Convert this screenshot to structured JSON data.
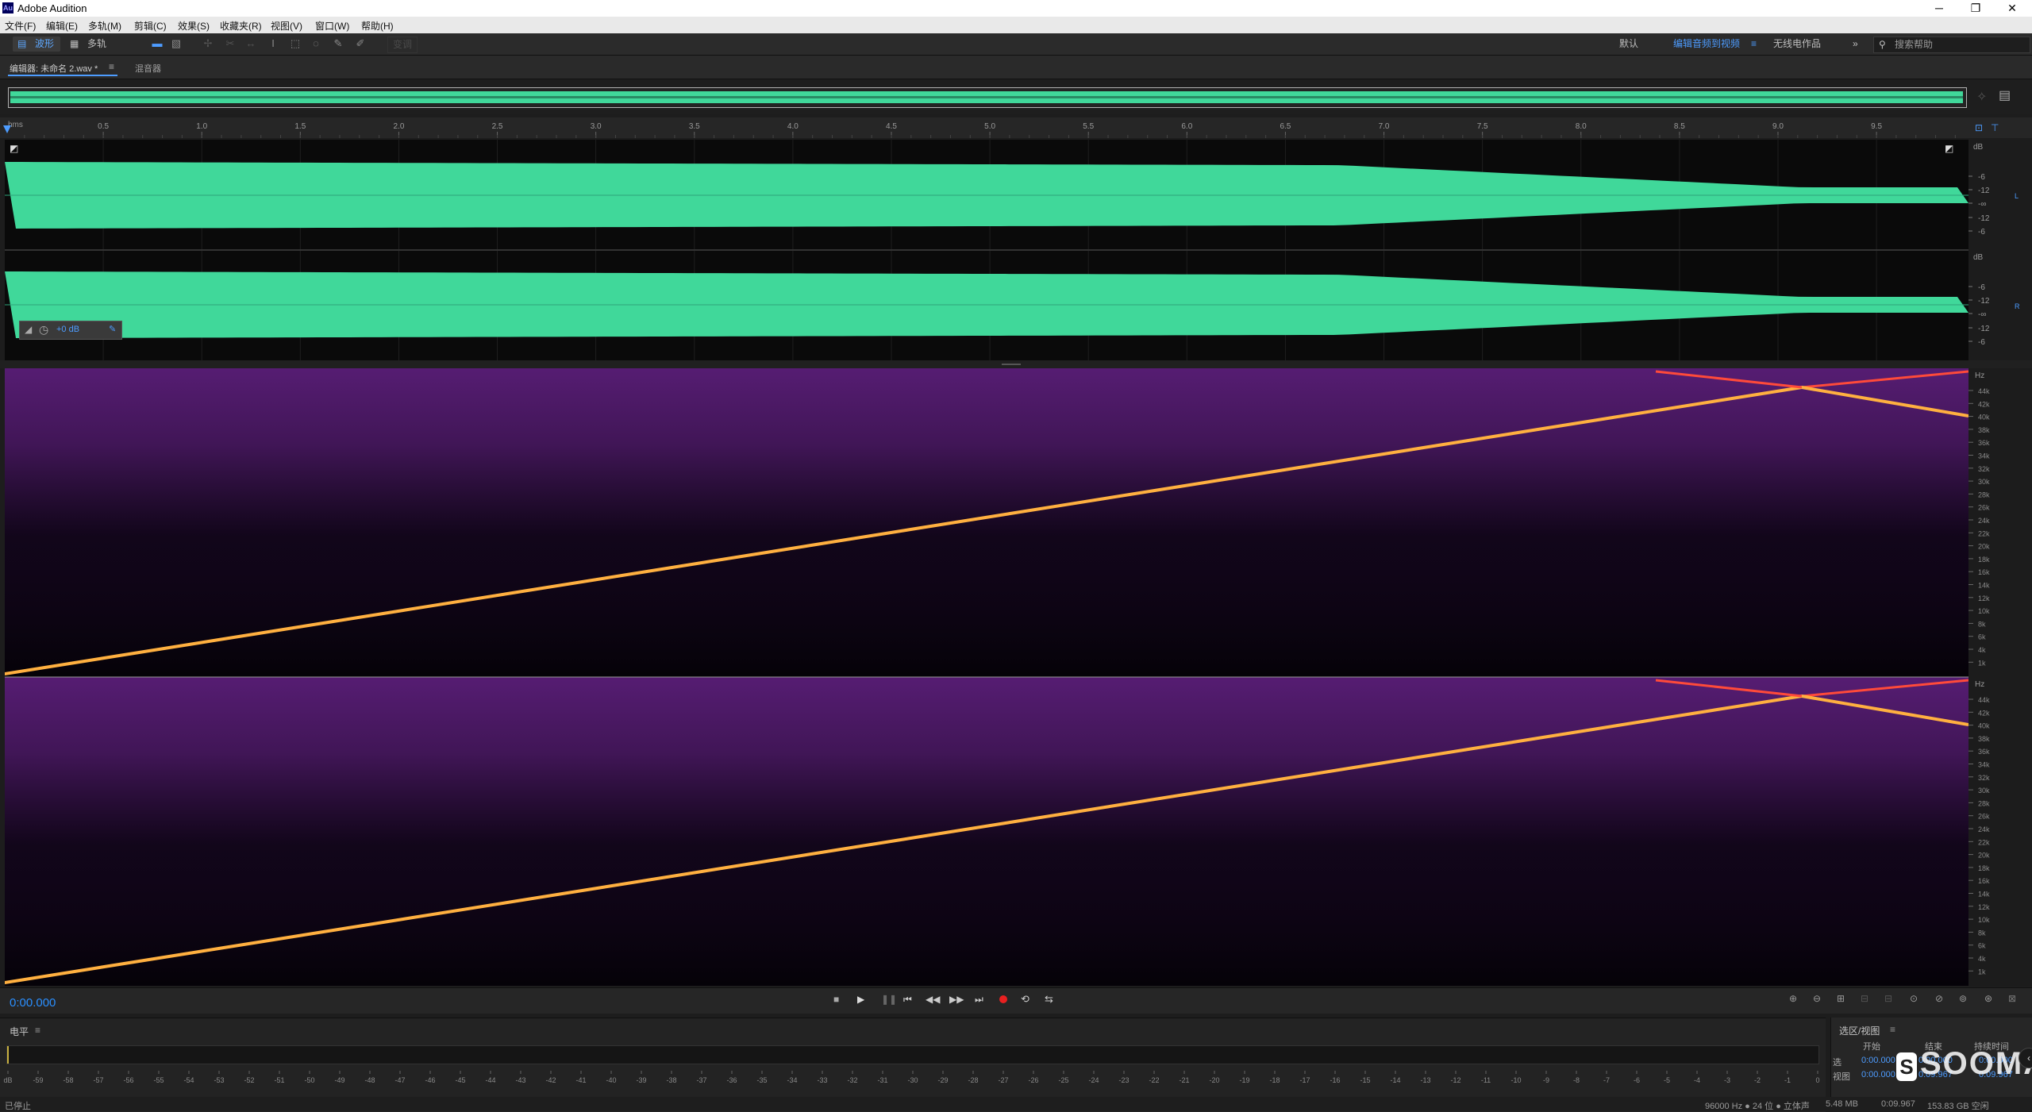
{
  "app": {
    "title": "Adobe Audition",
    "logo_text": "Au"
  },
  "window_controls": {
    "minimize": "─",
    "restore": "❐",
    "close": "✕"
  },
  "menu": [
    "文件(F)",
    "编辑(E)",
    "多轨(M)",
    "剪辑(C)",
    "效果(S)",
    "收藏夹(R)",
    "视图(V)",
    "窗口(W)",
    "帮助(H)"
  ],
  "toolbar": {
    "waveform_label": "波形",
    "multitrack_label": "多轨",
    "disabled_label": "变调",
    "workspaces": [
      "默认",
      "编辑音频到视频",
      "无线电作品"
    ],
    "active_workspace": "编辑音频到视频",
    "more": "»",
    "search_placeholder": "搜索帮助"
  },
  "panels": {
    "editor_tab": "编辑器: 未命名 2.wav *",
    "mixer_tab": "混音器",
    "menu_icon": "≡"
  },
  "ruler": {
    "unit": "hms",
    "ticks": [
      "0.5",
      "1.0",
      "1.5",
      "2.0",
      "2.5",
      "3.0",
      "3.5",
      "4.0",
      "4.5",
      "5.0",
      "5.5",
      "6.0",
      "6.5",
      "7.0",
      "7.5",
      "8.0",
      "8.5",
      "9.0",
      "9.5"
    ],
    "duration_s": 9.967
  },
  "waveform": {
    "color": "#40d89a",
    "db_unit": "dB",
    "db_ticks": [
      "-6",
      "-12",
      "-∞",
      "-12",
      "-6"
    ],
    "channel_left": "L",
    "channel_right": "R",
    "hud_gain": "+0 dB"
  },
  "spectrum": {
    "hz_unit": "Hz",
    "hz_ticks": [
      "44k",
      "42k",
      "40k",
      "38k",
      "36k",
      "34k",
      "32k",
      "30k",
      "28k",
      "26k",
      "24k",
      "22k",
      "20k",
      "18k",
      "16k",
      "14k",
      "12k",
      "10k",
      "8k",
      "6k",
      "4k",
      "1k"
    ],
    "sweep_color": "#ffb040",
    "alias_color": "#ff4a3a",
    "noise_color": "#5a1e78"
  },
  "transport": {
    "time": "0:00.000",
    "time_color": "#2a8fff",
    "record_color": "#e82020"
  },
  "levels": {
    "title": "电平",
    "scale": [
      "dB",
      "-59",
      "-58",
      "-57",
      "-56",
      "-55",
      "-54",
      "-53",
      "-52",
      "-51",
      "-50",
      "-49",
      "-48",
      "-47",
      "-46",
      "-45",
      "-44",
      "-43",
      "-42",
      "-41",
      "-40",
      "-39",
      "-38",
      "-37",
      "-36",
      "-35",
      "-34",
      "-33",
      "-32",
      "-31",
      "-30",
      "-29",
      "-28",
      "-27",
      "-26",
      "-25",
      "-24",
      "-23",
      "-22",
      "-21",
      "-20",
      "-19",
      "-18",
      "-17",
      "-16",
      "-15",
      "-14",
      "-13",
      "-12",
      "-11",
      "-10",
      "-9",
      "-8",
      "-7",
      "-6",
      "-5",
      "-4",
      "-3",
      "-2",
      "-1",
      "0"
    ]
  },
  "selection": {
    "title": "选区/视图",
    "headers": [
      "开始",
      "结束",
      "持续时间"
    ],
    "rows": [
      {
        "label": "选",
        "start": "0:00.000",
        "end": "0:00.000",
        "duration": "0:00.000"
      },
      {
        "label": "视图",
        "start": "0:00.000",
        "end": "0:09.967",
        "duration": "0:09.967"
      }
    ]
  },
  "status": {
    "left": "已停止",
    "format": "96000 Hz ● 24 位 ● 立体声",
    "size": "5.48 MB",
    "duration": "0:09.967",
    "free": "153.83 GB 空闲"
  },
  "watermark": "SOOMAL"
}
